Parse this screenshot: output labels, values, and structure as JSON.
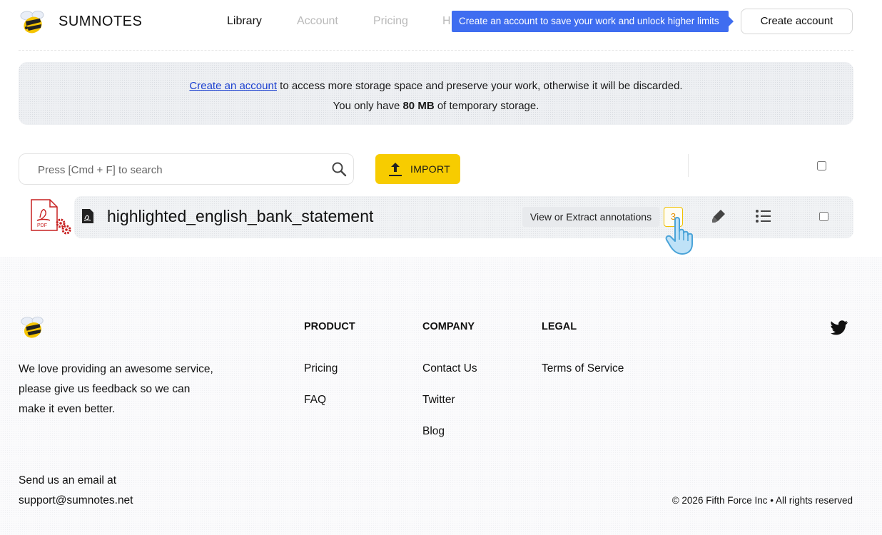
{
  "header": {
    "brand": "SUMNOTES",
    "nav": [
      {
        "label": "Library",
        "state": "active"
      },
      {
        "label": "Account",
        "state": "muted"
      },
      {
        "label": "Pricing",
        "state": "muted"
      },
      {
        "label": "H",
        "state": "muted"
      }
    ],
    "tooltip": "Create an account to save your work and unlock higher limits",
    "create_account": "Create account"
  },
  "banner": {
    "link_text": "Create an account",
    "line1_rest": " to access more storage space and preserve your work, otherwise it will be discarded.",
    "line2_prefix": "You only have ",
    "storage": "80 MB",
    "line2_suffix": " of temporary storage."
  },
  "toolbar": {
    "search_placeholder": "Press [Cmd + F] to search",
    "import_label": "IMPORT"
  },
  "files": [
    {
      "name": "highlighted_english_bank_statement",
      "annotations_label": "View or Extract annotations",
      "annotation_count": "3"
    }
  ],
  "footer": {
    "tagline": "We love providing an awesome service, please give us feedback so we can make it even better.",
    "columns": {
      "product": {
        "title": "PRODUCT",
        "links": [
          "Pricing",
          "FAQ"
        ]
      },
      "company": {
        "title": "COMPANY",
        "links": [
          "Contact Us",
          "Twitter",
          "Blog"
        ]
      },
      "legal": {
        "title": "LEGAL",
        "links": [
          "Terms of Service"
        ]
      }
    },
    "email_line1": "Send us an email at",
    "email": "support@sumnotes.net",
    "copyright": "© 2026 Fifth Force Inc • All rights reserved"
  },
  "colors": {
    "accent_yellow": "#f7cc00",
    "tooltip_blue": "#3f6df0",
    "link_blue": "#1a3fd0"
  }
}
